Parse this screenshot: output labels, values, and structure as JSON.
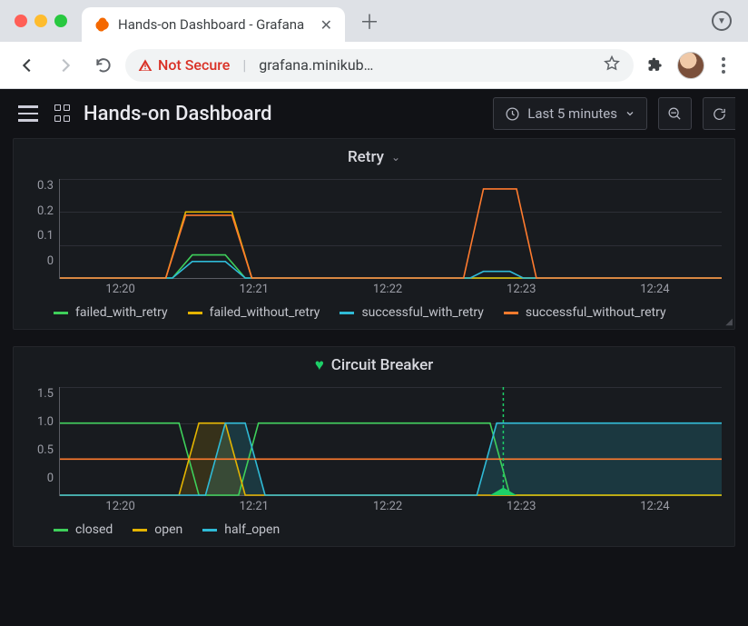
{
  "browser": {
    "tab_title": "Hands-on Dashboard - Grafana",
    "not_secure": "Not Secure",
    "url": "grafana.minikub…"
  },
  "toolbar": {
    "title": "Hands-on Dashboard",
    "timerange": "Last 5 minutes"
  },
  "panels": {
    "retry": {
      "title": "Retry",
      "y_ticks": [
        "0.3",
        "0.2",
        "0.1",
        "0"
      ],
      "x_ticks": [
        "12:20",
        "12:21",
        "12:22",
        "12:23",
        "12:24"
      ],
      "legend": [
        {
          "name": "failed_with_retry",
          "color": "#3ecf5a"
        },
        {
          "name": "failed_without_retry",
          "color": "#e4b400"
        },
        {
          "name": "successful_with_retry",
          "color": "#2fbad6"
        },
        {
          "name": "successful_without_retry",
          "color": "#ff7b2e"
        }
      ]
    },
    "cb": {
      "title": "Circuit Breaker",
      "y_ticks": [
        "1.5",
        "1.0",
        "0.5",
        "0"
      ],
      "x_ticks": [
        "12:20",
        "12:21",
        "12:22",
        "12:23",
        "12:24"
      ],
      "legend": [
        {
          "name": "closed",
          "color": "#3ecf5a"
        },
        {
          "name": "open",
          "color": "#e4b400"
        },
        {
          "name": "half_open",
          "color": "#2fbad6"
        }
      ]
    }
  },
  "chart_data": [
    {
      "type": "line",
      "title": "Retry",
      "xlabel": "",
      "ylabel": "",
      "ylim": [
        0,
        0.3
      ],
      "x_ticks": [
        "12:20",
        "12:21",
        "12:22",
        "12:23",
        "12:24"
      ],
      "series": [
        {
          "name": "failed_with_retry",
          "color": "#3ecf5a",
          "points": [
            [
              0,
              0
            ],
            [
              17,
              0
            ],
            [
              20,
              0.07
            ],
            [
              25,
              0.07
            ],
            [
              28,
              0
            ],
            [
              100,
              0
            ]
          ]
        },
        {
          "name": "failed_without_retry",
          "color": "#e4b400",
          "points": [
            [
              0,
              0
            ],
            [
              16,
              0
            ],
            [
              19,
              0.2
            ],
            [
              26,
              0.2
            ],
            [
              29,
              0
            ],
            [
              100,
              0
            ]
          ]
        },
        {
          "name": "successful_with_retry",
          "color": "#2fbad6",
          "points": [
            [
              0,
              0
            ],
            [
              17,
              0
            ],
            [
              20,
              0.05
            ],
            [
              25,
              0.05
            ],
            [
              28,
              0
            ],
            [
              62,
              0
            ],
            [
              64,
              0.02
            ],
            [
              68,
              0.02
            ],
            [
              70,
              0
            ],
            [
              100,
              0
            ]
          ]
        },
        {
          "name": "successful_without_retry",
          "color": "#ff7b2e",
          "points": [
            [
              0,
              0
            ],
            [
              16,
              0
            ],
            [
              19,
              0.19
            ],
            [
              26,
              0.19
            ],
            [
              29,
              0
            ],
            [
              61,
              0
            ],
            [
              64,
              0.27
            ],
            [
              69,
              0.27
            ],
            [
              72,
              0
            ],
            [
              100,
              0
            ]
          ]
        }
      ]
    },
    {
      "type": "line",
      "title": "Circuit Breaker",
      "xlabel": "",
      "ylabel": "",
      "ylim": [
        0,
        1.5
      ],
      "x_ticks": [
        "12:20",
        "12:21",
        "12:22",
        "12:23",
        "12:24"
      ],
      "marker_x": 67,
      "series": [
        {
          "name": "closed",
          "color": "#3ecf5a",
          "points": [
            [
              0,
              1.0
            ],
            [
              18,
              1.0
            ],
            [
              21,
              0.0
            ],
            [
              27,
              0.0
            ],
            [
              30,
              1.0
            ],
            [
              65,
              1.0
            ],
            [
              68,
              0.0
            ],
            [
              100,
              0.0
            ]
          ]
        },
        {
          "name": "open",
          "color": "#e4b400",
          "points": [
            [
              0,
              0.0
            ],
            [
              18,
              0.0
            ],
            [
              21,
              1.0
            ],
            [
              25,
              1.0
            ],
            [
              28,
              0.0
            ],
            [
              100,
              0.0
            ]
          ]
        },
        {
          "name": "half_open",
          "color": "#2fbad6",
          "points": [
            [
              0,
              0.0
            ],
            [
              22,
              0.0
            ],
            [
              25,
              1.0
            ],
            [
              28,
              1.0
            ],
            [
              31,
              0.0
            ],
            [
              63,
              0.0
            ],
            [
              66,
              1.0
            ],
            [
              100,
              1.0
            ]
          ]
        },
        {
          "name": "orange_mid",
          "color": "#ff7b2e",
          "points": [
            [
              0,
              0.5
            ],
            [
              100,
              0.5
            ]
          ]
        }
      ],
      "fills": [
        {
          "series": "half_open",
          "color": "rgba(47,186,214,0.18)"
        },
        {
          "series": "open",
          "color": "rgba(228,180,0,0.15)"
        }
      ]
    }
  ]
}
